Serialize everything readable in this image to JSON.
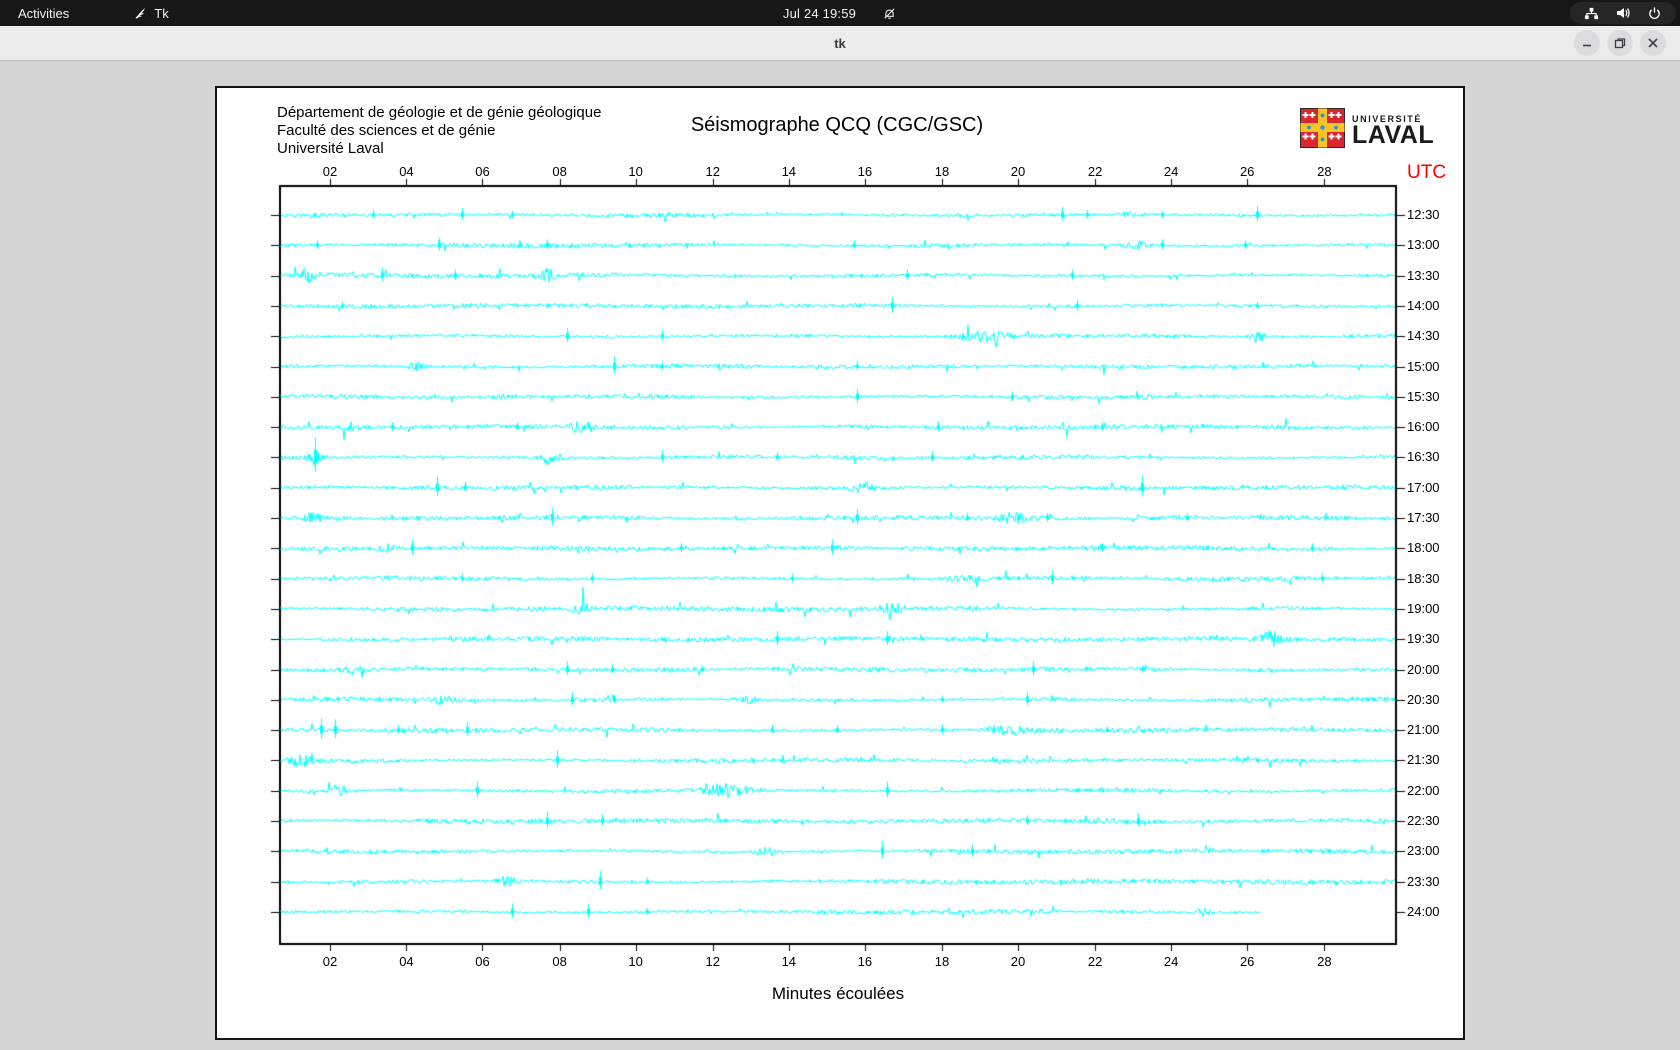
{
  "topbar": {
    "activities_label": "Activities",
    "app_indicator": "Tk",
    "clock": "Jul 24 19:59",
    "icons": [
      "tk-icon",
      "bell-muted-icon",
      "network-icon",
      "volume-icon",
      "power-icon"
    ]
  },
  "window": {
    "title": "tk",
    "buttons": [
      "minimize",
      "maximize",
      "close"
    ]
  },
  "header": {
    "address_lines": [
      "Département de géologie et de génie géologique",
      "Faculté des sciences et de génie",
      "Université Laval"
    ],
    "title": "Séismographe QCQ (CGC/GSC)",
    "logo": {
      "line1": "UNIVERSITÉ",
      "line2": "LAVAL"
    }
  },
  "colors": {
    "trace": "#00ffff",
    "utc_label": "#ff0000",
    "axis": "#000000",
    "topbar_bg": "#171717",
    "titlebar_bg": "#ebebeb",
    "desktop_bg": "#d5d5d5"
  },
  "chart_data": {
    "type": "line",
    "subtype": "seismogram-helicorder",
    "title": "Séismographe QCQ (CGC/GSC)",
    "xlabel": "Minutes écoulées",
    "right_axis_label": "UTC",
    "x_ticks": [
      "02",
      "04",
      "06",
      "08",
      "10",
      "12",
      "14",
      "16",
      "18",
      "20",
      "22",
      "24",
      "26",
      "28"
    ],
    "x_tick_fracs": [
      0.0456,
      0.114,
      0.182,
      0.251,
      0.319,
      0.388,
      0.456,
      0.524,
      0.593,
      0.661,
      0.73,
      0.798,
      0.866,
      0.935
    ],
    "xlim_minutes": [
      0,
      30
    ],
    "grid": false,
    "trace_color": "#00ffff",
    "note": "events = [x_fraction, amplitude_px, burst_halfwidth_px(0=sharp spike)]",
    "rows": [
      {
        "utc": "12:30",
        "end": 1.0,
        "events": [
          [
            0.084,
            5,
            0
          ],
          [
            0.164,
            7,
            0
          ],
          [
            0.208,
            4,
            0
          ],
          [
            0.7,
            8,
            0
          ],
          [
            0.723,
            5,
            0
          ],
          [
            0.763,
            3,
            8
          ],
          [
            0.79,
            4,
            0
          ],
          [
            0.875,
            9,
            0
          ]
        ]
      },
      {
        "utc": "13:00",
        "end": 1.0,
        "events": [
          [
            0.034,
            5,
            0
          ],
          [
            0.143,
            8,
            0
          ],
          [
            0.24,
            6,
            0
          ],
          [
            0.514,
            5,
            0
          ],
          [
            0.767,
            4,
            10
          ],
          [
            0.79,
            6,
            0
          ],
          [
            0.864,
            5,
            0
          ]
        ]
      },
      {
        "utc": "13:30",
        "end": 1.0,
        "events": [
          [
            0.025,
            6,
            6
          ],
          [
            0.092,
            8,
            0
          ],
          [
            0.157,
            6,
            0
          ],
          [
            0.24,
            5,
            6
          ],
          [
            0.562,
            6,
            0
          ],
          [
            0.709,
            6,
            0
          ]
        ]
      },
      {
        "utc": "14:00",
        "end": 1.0,
        "events": [
          [
            0.056,
            4,
            0
          ],
          [
            0.548,
            9,
            0
          ],
          [
            0.714,
            6,
            0
          ],
          [
            0.875,
            4,
            0
          ]
        ]
      },
      {
        "utc": "14:30",
        "end": 1.0,
        "events": [
          [
            0.258,
            8,
            0
          ],
          [
            0.343,
            6,
            0
          ],
          [
            0.633,
            5,
            20
          ],
          [
            0.875,
            5,
            6
          ]
        ]
      },
      {
        "utc": "15:00",
        "end": 1.0,
        "events": [
          [
            0.123,
            4,
            6
          ],
          [
            0.3,
            10,
            0
          ],
          [
            0.343,
            5,
            0
          ],
          [
            0.517,
            5,
            0
          ]
        ]
      },
      {
        "utc": "15:30",
        "end": 1.0,
        "events": [
          [
            0.517,
            8,
            0
          ],
          [
            0.656,
            5,
            0
          ]
        ]
      },
      {
        "utc": "16:00",
        "end": 1.0,
        "events": [
          [
            0.061,
            5,
            6
          ],
          [
            0.101,
            5,
            0
          ],
          [
            0.213,
            5,
            0
          ],
          [
            0.271,
            5,
            8
          ],
          [
            0.589,
            6,
            0
          ],
          [
            0.736,
            5,
            0
          ]
        ]
      },
      {
        "utc": "16:30",
        "end": 1.0,
        "events": [
          [
            0.032,
            20,
            0
          ],
          [
            0.032,
            6,
            4
          ],
          [
            0.242,
            6,
            8
          ],
          [
            0.343,
            7,
            0
          ],
          [
            0.445,
            5,
            0
          ],
          [
            0.584,
            6,
            0
          ]
        ]
      },
      {
        "utc": "17:00",
        "end": 1.0,
        "events": [
          [
            0.141,
            11,
            0
          ],
          [
            0.166,
            6,
            0
          ],
          [
            0.522,
            5,
            7
          ],
          [
            0.772,
            12,
            0
          ]
        ]
      },
      {
        "utc": "17:30",
        "end": 1.0,
        "events": [
          [
            0.03,
            4,
            6
          ],
          [
            0.244,
            10,
            0
          ],
          [
            0.517,
            9,
            0
          ],
          [
            0.615,
            5,
            0
          ],
          [
            0.656,
            5,
            8
          ],
          [
            0.687,
            5,
            0
          ],
          [
            0.812,
            5,
            0
          ]
        ]
      },
      {
        "utc": "18:00",
        "end": 1.0,
        "events": [
          [
            0.097,
            4,
            6
          ],
          [
            0.119,
            9,
            0
          ],
          [
            0.36,
            5,
            0
          ],
          [
            0.495,
            9,
            0
          ],
          [
            0.736,
            5,
            0
          ],
          [
            0.924,
            5,
            0
          ]
        ]
      },
      {
        "utc": "18:30",
        "end": 1.0,
        "events": [
          [
            0.164,
            5,
            0
          ],
          [
            0.28,
            5,
            0
          ],
          [
            0.459,
            5,
            0
          ],
          [
            0.615,
            4,
            8
          ],
          [
            0.691,
            8,
            0
          ],
          [
            0.933,
            5,
            0
          ]
        ]
      },
      {
        "utc": "19:00",
        "end": 1.0,
        "events": [
          [
            0.271,
            6,
            6
          ],
          [
            0.548,
            5,
            7
          ]
        ]
      },
      {
        "utc": "19:30",
        "end": 1.0,
        "events": [
          [
            0.445,
            8,
            0
          ],
          [
            0.544,
            8,
            0
          ],
          [
            0.888,
            7,
            7
          ]
        ]
      },
      {
        "utc": "20:00",
        "end": 1.0,
        "events": [
          [
            0.07,
            4,
            7
          ],
          [
            0.258,
            8,
            0
          ],
          [
            0.298,
            5,
            0
          ],
          [
            0.378,
            4,
            0
          ],
          [
            0.674,
            8,
            0
          ],
          [
            0.772,
            4,
            0
          ]
        ]
      },
      {
        "utc": "20:30",
        "end": 1.0,
        "events": [
          [
            0.146,
            4,
            7
          ],
          [
            0.262,
            8,
            0
          ],
          [
            0.3,
            5,
            0
          ],
          [
            0.419,
            4,
            6
          ],
          [
            0.593,
            4,
            0
          ],
          [
            0.669,
            8,
            0
          ]
        ]
      },
      {
        "utc": "21:00",
        "end": 1.0,
        "events": [
          [
            0.038,
            12,
            0
          ],
          [
            0.05,
            11,
            0
          ],
          [
            0.106,
            5,
            0
          ],
          [
            0.168,
            8,
            0
          ],
          [
            0.441,
            5,
            0
          ],
          [
            0.499,
            5,
            0
          ],
          [
            0.593,
            6,
            0
          ],
          [
            0.647,
            5,
            12
          ],
          [
            0.741,
            4,
            0
          ]
        ]
      },
      {
        "utc": "21:30",
        "end": 1.0,
        "events": [
          [
            0.019,
            6,
            7
          ],
          [
            0.249,
            10,
            0
          ],
          [
            0.875,
            3,
            0
          ]
        ]
      },
      {
        "utc": "22:00",
        "end": 1.0,
        "events": [
          [
            0.053,
            6,
            6
          ],
          [
            0.177,
            9,
            0
          ],
          [
            0.401,
            6,
            16
          ],
          [
            0.544,
            9,
            0
          ]
        ]
      },
      {
        "utc": "22:30",
        "end": 1.0,
        "events": [
          [
            0.24,
            9,
            0
          ],
          [
            0.289,
            7,
            0
          ],
          [
            0.669,
            6,
            0
          ],
          [
            0.768,
            8,
            0
          ]
        ]
      },
      {
        "utc": "23:00",
        "end": 1.0,
        "events": [
          [
            0.437,
            4,
            7
          ],
          [
            0.539,
            10,
            0
          ],
          [
            0.62,
            7,
            0
          ]
        ]
      },
      {
        "utc": "23:30",
        "end": 1.0,
        "events": [
          [
            0.204,
            4,
            7
          ],
          [
            0.287,
            11,
            0
          ],
          [
            0.329,
            4,
            0
          ]
        ]
      },
      {
        "utc": "24:00",
        "end": 0.88,
        "events": [
          [
            0.208,
            8,
            0
          ],
          [
            0.276,
            8,
            0
          ],
          [
            0.329,
            4,
            0
          ],
          [
            0.826,
            4,
            6
          ]
        ]
      }
    ]
  }
}
